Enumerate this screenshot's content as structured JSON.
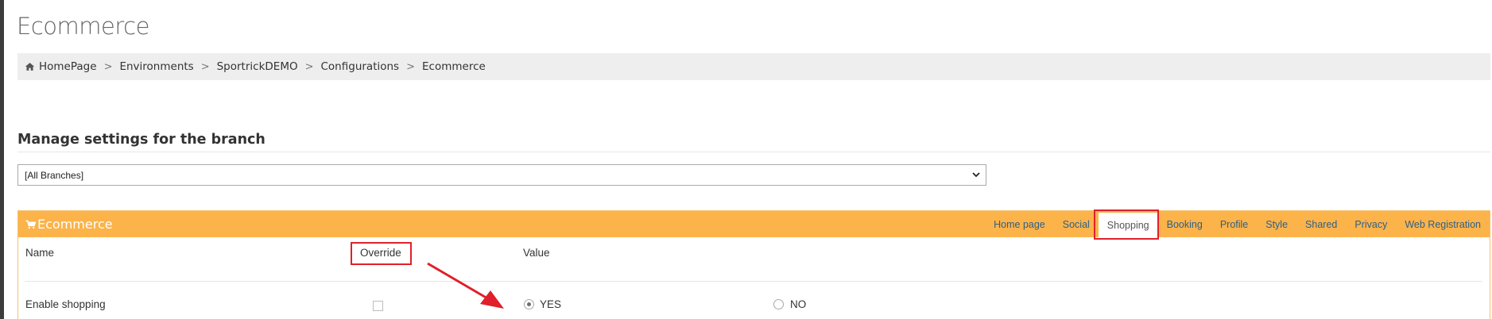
{
  "page": {
    "title": "Ecommerce"
  },
  "breadcrumb": {
    "items": [
      "HomePage",
      "Environments",
      "SportrickDEMO",
      "Configurations",
      "Ecommerce"
    ],
    "separator": ">"
  },
  "branch_settings": {
    "heading": "Manage settings for the branch",
    "selected_branch": "[All Branches]"
  },
  "panel": {
    "title": "Ecommerce",
    "header_color": "#fcb34a",
    "tabs": [
      "Home page",
      "Social",
      "Shopping",
      "Booking",
      "Profile",
      "Style",
      "Shared",
      "Privacy",
      "Web Registration"
    ],
    "active_tab": "Shopping",
    "columns": {
      "name": "Name",
      "override": "Override",
      "value": "Value"
    },
    "rows": [
      {
        "name": "Enable shopping",
        "override_checked": false,
        "yes_label": "YES",
        "no_label": "NO",
        "selected": "YES"
      }
    ]
  },
  "annotation_color": "#e0202a"
}
